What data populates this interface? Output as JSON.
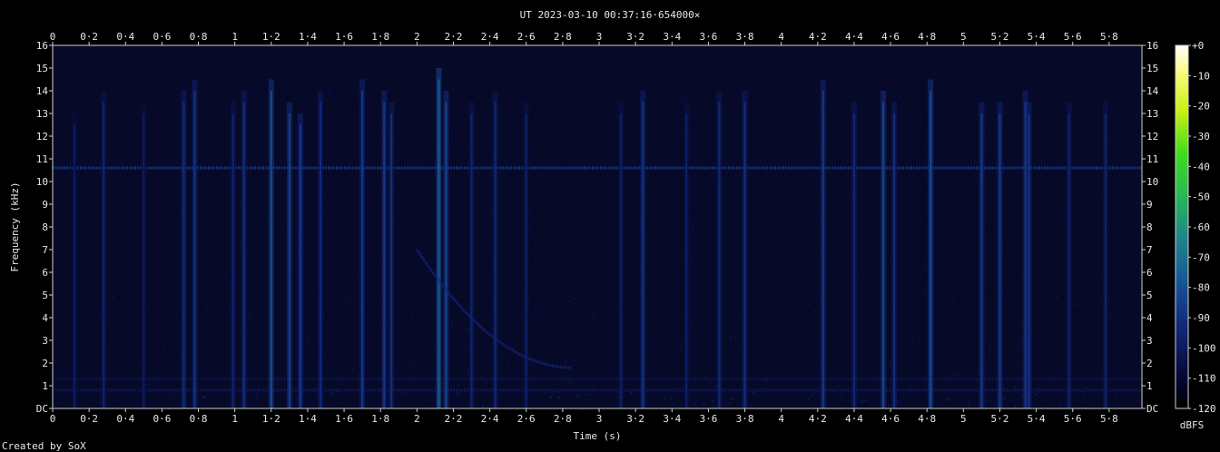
{
  "chart_data": {
    "type": "heatmap",
    "title": "UT 2023-03-10 00:37:16·654000×",
    "xlabel": "Time (s)",
    "ylabel": "Frequency (kHz)",
    "xlim": [
      0,
      5.98
    ],
    "ylim": [
      0,
      16
    ],
    "x_ticks": [
      "0",
      "0·2",
      "0·4",
      "0·6",
      "0·8",
      "1",
      "1·2",
      "1·4",
      "1·6",
      "1·8",
      "2",
      "2·2",
      "2·4",
      "2·6",
      "2·8",
      "3",
      "3·2",
      "3·4",
      "3·6",
      "3·8",
      "4",
      "4·2",
      "4·4",
      "4·6",
      "4·8",
      "5",
      "5·2",
      "5·4",
      "5·6",
      "5·8"
    ],
    "x_tick_values": [
      0,
      0.2,
      0.4,
      0.6,
      0.8,
      1,
      1.2,
      1.4,
      1.6,
      1.8,
      2,
      2.2,
      2.4,
      2.6,
      2.8,
      3,
      3.2,
      3.4,
      3.6,
      3.8,
      4,
      4.2,
      4.4,
      4.6,
      4.8,
      5,
      5.2,
      5.4,
      5.6,
      5.8
    ],
    "y_ticks": [
      "DC",
      "1",
      "2",
      "3",
      "4",
      "5",
      "6",
      "7",
      "8",
      "9",
      "10",
      "11",
      "12",
      "13",
      "14",
      "15",
      "16"
    ],
    "y_tick_values": [
      0,
      1,
      2,
      3,
      4,
      5,
      6,
      7,
      8,
      9,
      10,
      11,
      12,
      13,
      14,
      15,
      16
    ],
    "colorbar": {
      "label": "dBFS",
      "ticks": [
        "+0",
        "-10",
        "-20",
        "-30",
        "-40",
        "-50",
        "-60",
        "-70",
        "-80",
        "-90",
        "-100",
        "-110",
        "-120"
      ],
      "tick_values": [
        0,
        -10,
        -20,
        -30,
        -40,
        -50,
        -60,
        -70,
        -80,
        -90,
        -100,
        -110,
        -120
      ],
      "range": [
        -120,
        0
      ]
    },
    "background_level_dbfs": -108,
    "horizontal_lines": [
      {
        "freq_khz": 10.6,
        "level_dbfs": -90
      },
      {
        "freq_khz": 1.3,
        "level_dbfs": -104
      },
      {
        "freq_khz": 0.8,
        "level_dbfs": -102
      }
    ],
    "vertical_events": [
      {
        "t": 0.12,
        "f_top": 13.0,
        "level_dbfs": -98
      },
      {
        "t": 0.28,
        "f_top": 14.0,
        "level_dbfs": -94
      },
      {
        "t": 0.5,
        "f_top": 13.5,
        "level_dbfs": -98
      },
      {
        "t": 0.72,
        "f_top": 14.0,
        "level_dbfs": -90
      },
      {
        "t": 0.78,
        "f_top": 14.5,
        "level_dbfs": -88
      },
      {
        "t": 0.99,
        "f_top": 13.5,
        "level_dbfs": -94
      },
      {
        "t": 1.05,
        "f_top": 14.0,
        "level_dbfs": -90
      },
      {
        "t": 1.2,
        "f_top": 14.5,
        "level_dbfs": -80
      },
      {
        "t": 1.3,
        "f_top": 13.5,
        "level_dbfs": -84
      },
      {
        "t": 1.36,
        "f_top": 13.0,
        "level_dbfs": -86
      },
      {
        "t": 1.47,
        "f_top": 14.0,
        "level_dbfs": -92
      },
      {
        "t": 1.7,
        "f_top": 14.5,
        "level_dbfs": -86
      },
      {
        "t": 1.82,
        "f_top": 14.0,
        "level_dbfs": -86
      },
      {
        "t": 1.86,
        "f_top": 13.5,
        "level_dbfs": -90
      },
      {
        "t": 2.12,
        "f_top": 15.0,
        "level_dbfs": -74
      },
      {
        "t": 2.16,
        "f_top": 14.0,
        "level_dbfs": -82
      },
      {
        "t": 2.3,
        "f_top": 13.5,
        "level_dbfs": -94
      },
      {
        "t": 2.43,
        "f_top": 14.0,
        "level_dbfs": -92
      },
      {
        "t": 2.6,
        "f_top": 13.5,
        "level_dbfs": -96
      },
      {
        "t": 3.12,
        "f_top": 13.5,
        "level_dbfs": -96
      },
      {
        "t": 3.24,
        "f_top": 14.0,
        "level_dbfs": -88
      },
      {
        "t": 3.48,
        "f_top": 13.5,
        "level_dbfs": -96
      },
      {
        "t": 3.66,
        "f_top": 14.0,
        "level_dbfs": -92
      },
      {
        "t": 3.8,
        "f_top": 14.0,
        "level_dbfs": -90
      },
      {
        "t": 4.23,
        "f_top": 14.5,
        "level_dbfs": -86
      },
      {
        "t": 4.4,
        "f_top": 13.5,
        "level_dbfs": -92
      },
      {
        "t": 4.56,
        "f_top": 14.0,
        "level_dbfs": -82
      },
      {
        "t": 4.62,
        "f_top": 13.5,
        "level_dbfs": -90
      },
      {
        "t": 4.82,
        "f_top": 14.5,
        "level_dbfs": -80
      },
      {
        "t": 5.1,
        "f_top": 13.5,
        "level_dbfs": -86
      },
      {
        "t": 5.2,
        "f_top": 13.5,
        "level_dbfs": -86
      },
      {
        "t": 5.34,
        "f_top": 14.0,
        "level_dbfs": -86
      },
      {
        "t": 5.36,
        "f_top": 13.5,
        "level_dbfs": -88
      },
      {
        "t": 5.58,
        "f_top": 13.5,
        "level_dbfs": -94
      },
      {
        "t": 5.78,
        "f_top": 13.5,
        "level_dbfs": -94
      }
    ],
    "chirp": {
      "t_start": 2.0,
      "t_end": 2.85,
      "f_start_khz": 7.0,
      "f_end_khz": 1.8,
      "level_dbfs": -94
    }
  },
  "credit": "Created by SoX"
}
